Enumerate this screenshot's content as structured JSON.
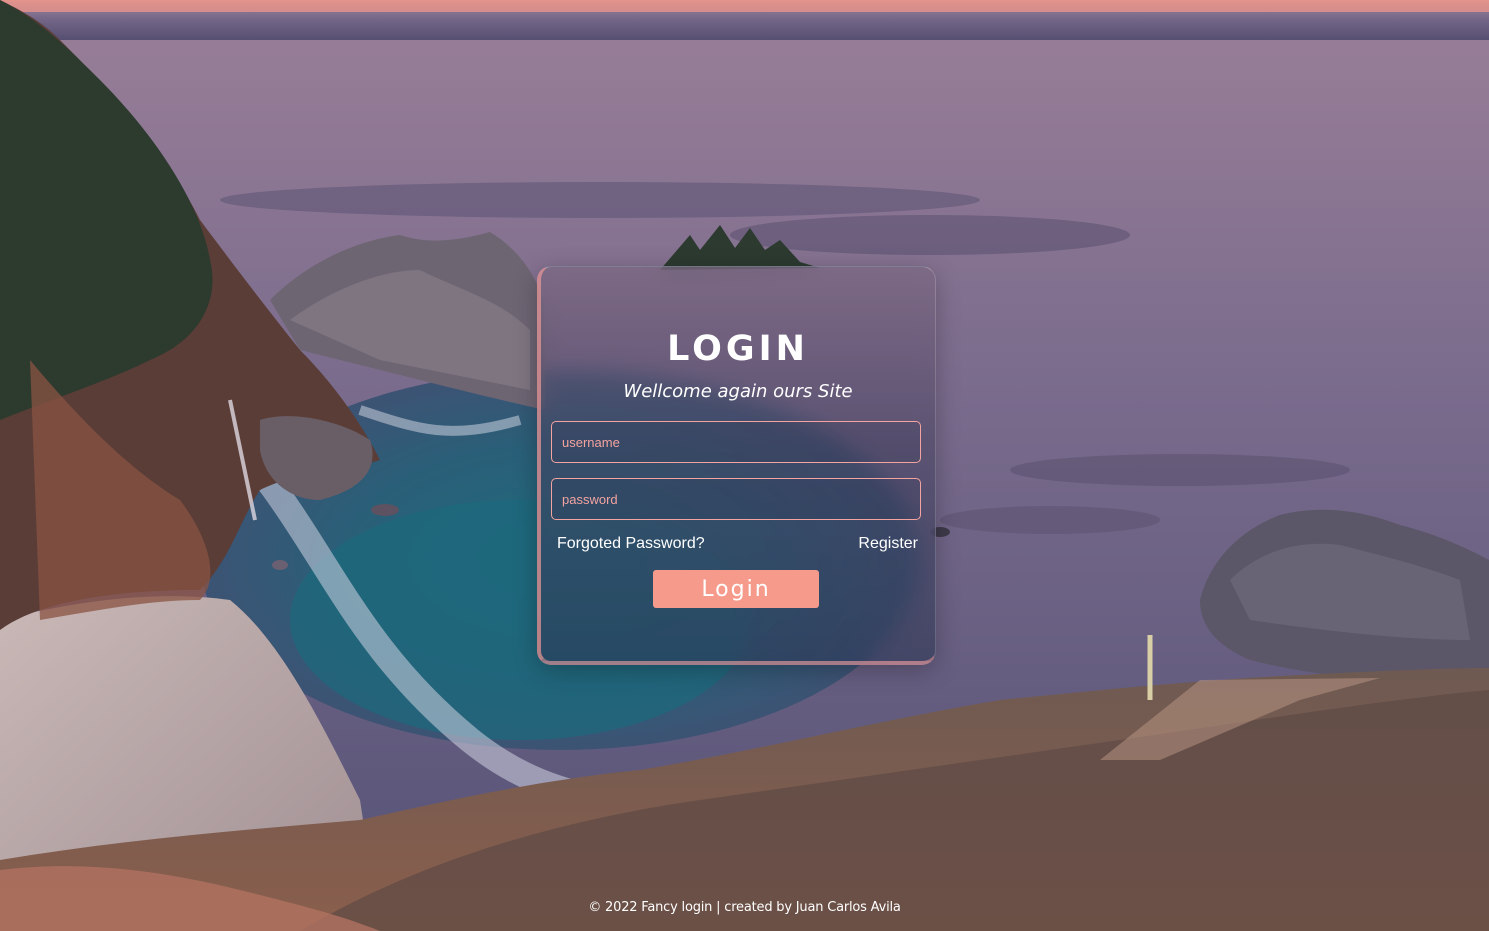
{
  "login": {
    "title": "LOGIN",
    "subtitle": "Wellcome again ours Site",
    "username_placeholder": "username",
    "password_placeholder": "password",
    "forgot_link": "Forgoted Password?",
    "register_link": "Register",
    "submit_label": "Login"
  },
  "footer": {
    "text": "© 2022 Fancy login | created by Juan Carlos Avila"
  },
  "colors": {
    "accent": "#f69a8c",
    "field_border": "#f3a3a0",
    "text": "#ffffff"
  }
}
